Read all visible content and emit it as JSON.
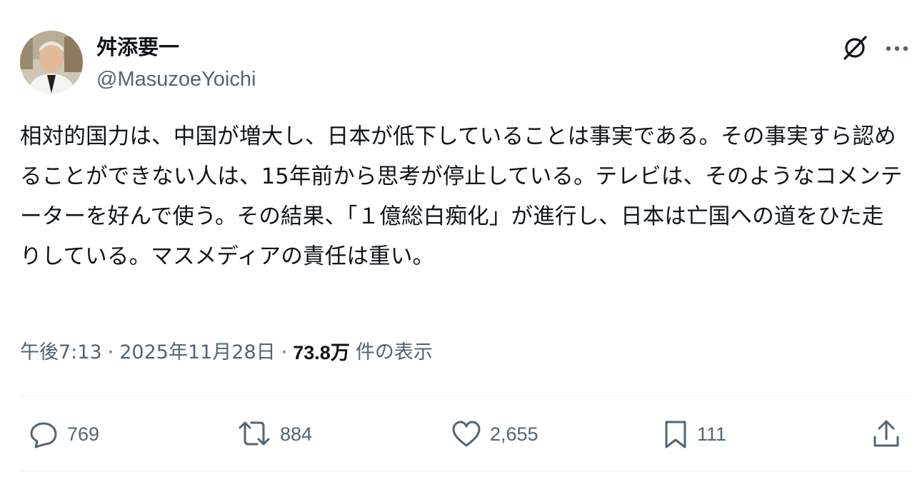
{
  "author": {
    "name": "舛添要一",
    "handle": "@MasuzoeYoichi"
  },
  "tweet": {
    "text": "相対的国力は、中国が増大し、日本が低下していることは事実である。その事実すら認めることができない人は、15年前から思考が停止している。テレビは、そのようなコメンテーターを好んで使う。その結果、「１億総白痴化」が進行し、日本は亡国への道をひた走りしている。マスメディアの責任は重い。"
  },
  "meta": {
    "time": "午後7:13",
    "separator": "·",
    "date": "2025年11月28日",
    "views": "73.8万",
    "views_label": "件の表示"
  },
  "actions": {
    "replies": "769",
    "reposts": "884",
    "likes": "2,655",
    "bookmarks": "111"
  },
  "icons": {
    "grok": "grok-icon",
    "more": "more-icon",
    "reply": "reply-icon",
    "repost": "repost-icon",
    "like": "heart-icon",
    "bookmark": "bookmark-icon",
    "share": "share-icon"
  },
  "colors": {
    "text": "#0f1419",
    "secondary": "#536471",
    "divider": "#eff3f4"
  }
}
